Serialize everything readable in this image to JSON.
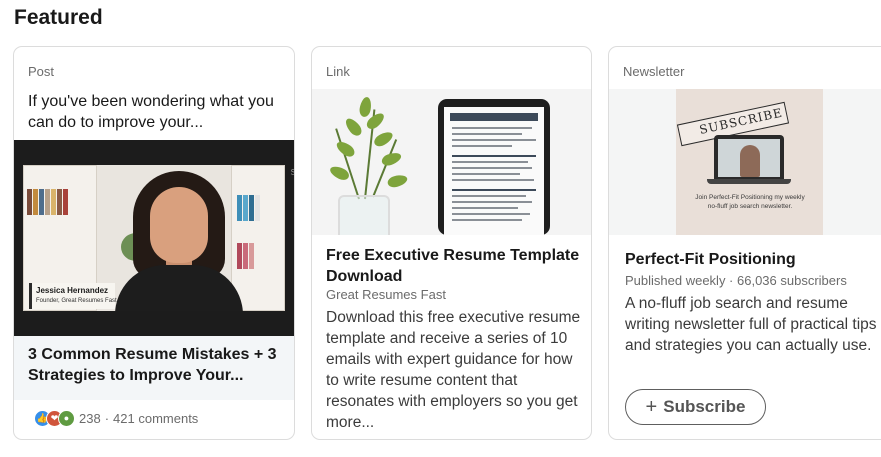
{
  "section": {
    "title": "Featured"
  },
  "cards": [
    {
      "kind": "Post",
      "excerpt": "If you've been wondering what you can do to improve your...",
      "video": {
        "name": "Jessica Hernandez",
        "role": "Founder, Great Resumes Fast",
        "edge_text": "S"
      },
      "title": "3 Common Resume Mistakes + 3 Strategies to Improve Your...",
      "reactions": [
        "like",
        "celebrate",
        "support"
      ],
      "reaction_count": "238",
      "separator": "·",
      "comments": "421 comments"
    },
    {
      "kind": "Link",
      "title": "Free Executive Resume Template Download",
      "source": "Great Resumes Fast",
      "description": "Download this free executive resume template and receive a series of 10 emails with expert guidance for how to write resume content that resonates with employers so you get more..."
    },
    {
      "kind": "Newsletter",
      "poster": {
        "ribbon": "SUBSCRIBE",
        "text": "Join Perfect-Fit Positioning my weekly no-fluff job search newsletter."
      },
      "title": "Perfect-Fit Positioning",
      "meta": "Published weekly · 66,036 subscribers",
      "description": "A no-fluff job search and resume writing newsletter full of practical tips and strategies you can actually use.",
      "button": {
        "icon": "+",
        "label": "Subscribe"
      }
    }
  ],
  "colors": {
    "like": "#378fe9",
    "celebrate": "#d0553b",
    "support": "#5f9b41",
    "muted_text": "#6b6b6b",
    "card_border": "#dcdcdc"
  }
}
